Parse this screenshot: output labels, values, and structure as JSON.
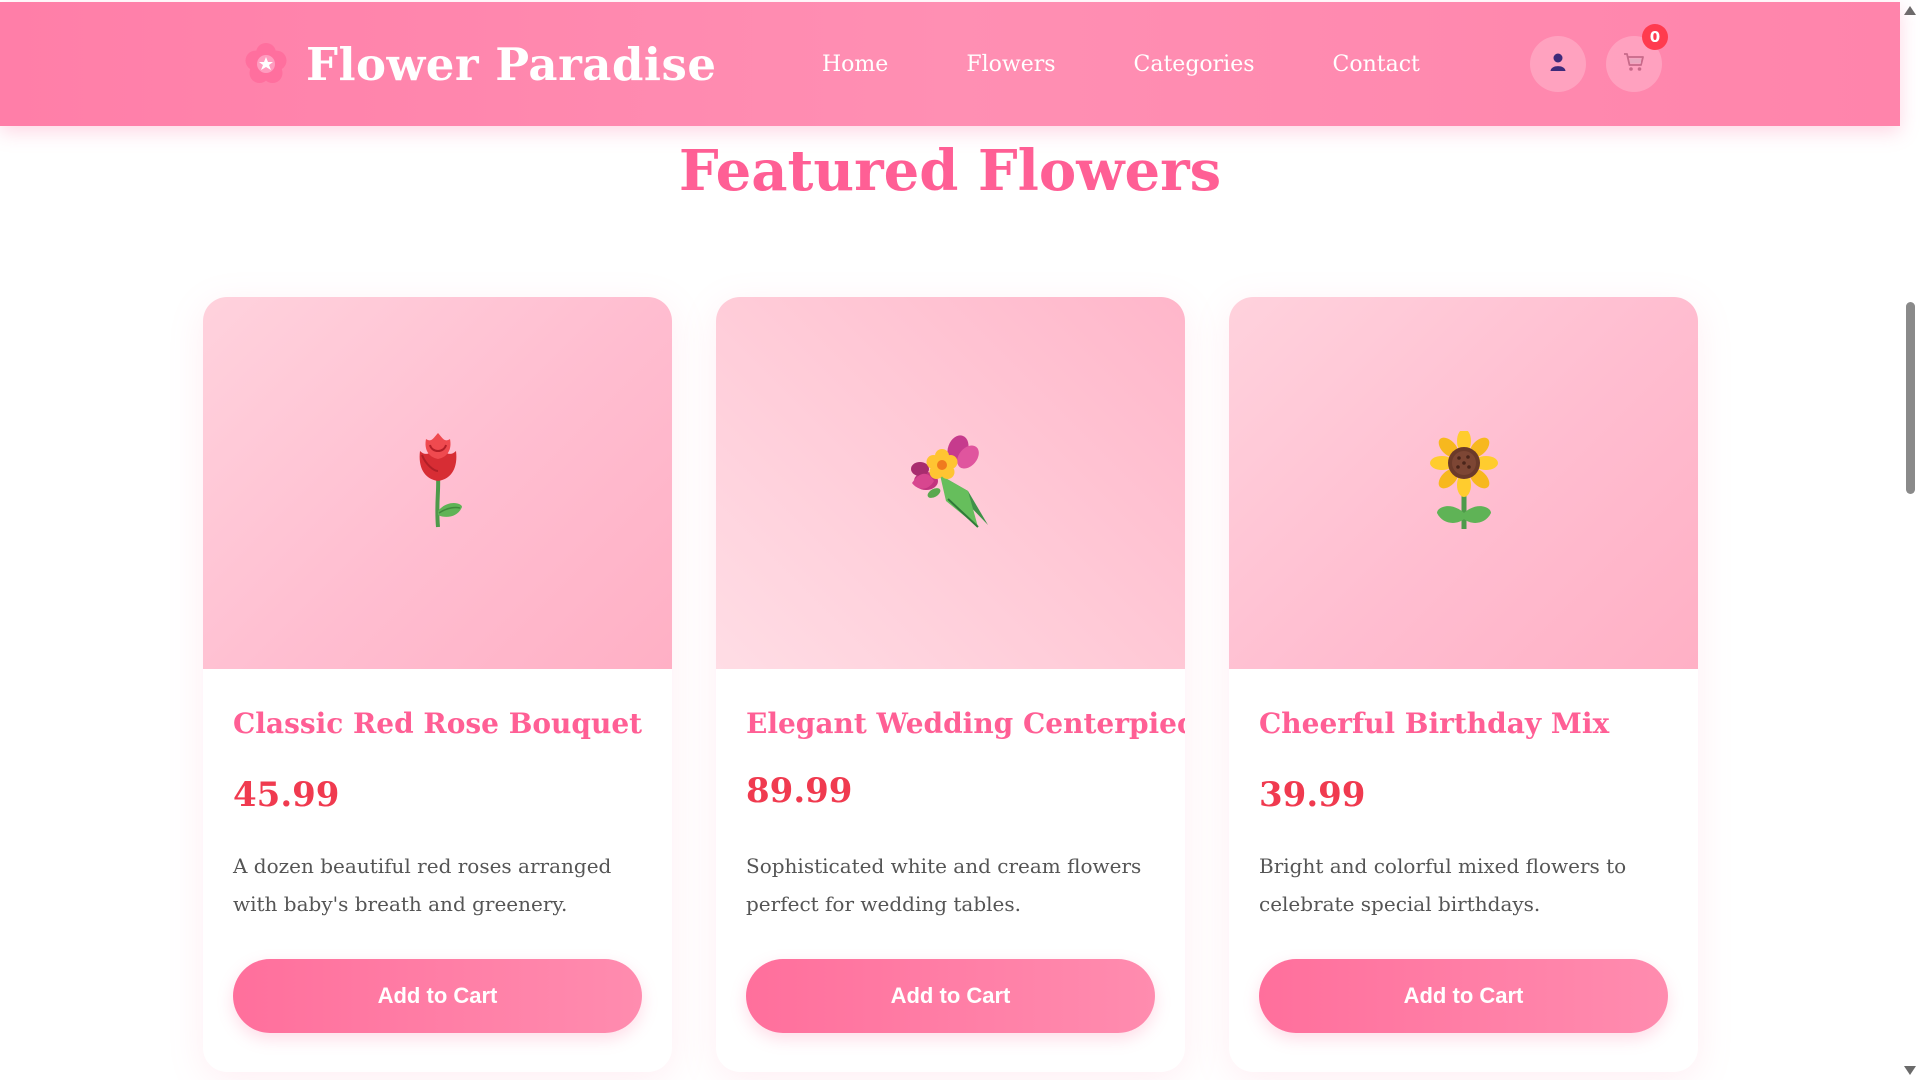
{
  "header": {
    "brand_name": "Flower Paradise",
    "logo_icon": "cherry-blossom-icon",
    "nav": [
      {
        "label": "Home"
      },
      {
        "label": "Flowers"
      },
      {
        "label": "Categories"
      },
      {
        "label": "Contact"
      }
    ],
    "user_icon": "user-icon",
    "cart_icon": "cart-icon",
    "cart_count": "0"
  },
  "featured": {
    "title": "Featured Flowers",
    "products": [
      {
        "name": "Classic Red Rose Bouquet",
        "price": "45.99",
        "description": "A dozen beautiful red roses arranged with baby's breath and greenery.",
        "button_label": "Add to Cart",
        "image_icon": "rose-icon"
      },
      {
        "name": "Elegant Wedding Centerpiece",
        "price": "89.99",
        "description": "Sophisticated white and cream flowers perfect for wedding tables.",
        "button_label": "Add to Cart",
        "image_icon": "bouquet-icon"
      },
      {
        "name": "Cheerful Birthday Mix",
        "price": "39.99",
        "description": "Bright and colorful mixed flowers to celebrate special birthdays.",
        "button_label": "Add to Cart",
        "image_icon": "sunflower-icon"
      }
    ]
  },
  "colors": {
    "header_pink": "#ff85ac",
    "title_pink": "#ff5f95",
    "price_red": "#f03a4f",
    "badge_red": "#ff3b4f"
  }
}
